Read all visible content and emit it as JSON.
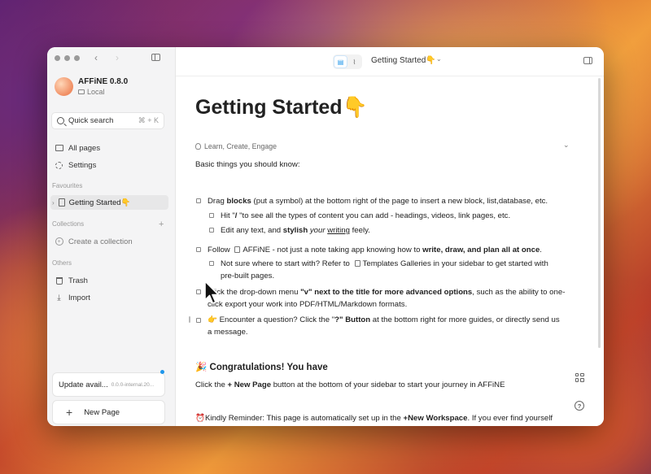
{
  "sidebar": {
    "workspace": {
      "name": "AFFiNE 0.8.0",
      "storage": "Local"
    },
    "quick_search": {
      "label": "Quick search",
      "shortcut": "⌘ + K"
    },
    "nav": [
      {
        "label": "All pages",
        "icon": "folder-icon"
      },
      {
        "label": "Settings",
        "icon": "gear-icon"
      }
    ],
    "favourites_label": "Favourites",
    "favourites": [
      {
        "label": "Getting Started👇"
      }
    ],
    "collections_label": "Collections",
    "create_collection": "Create a collection",
    "others_label": "Others",
    "others": [
      {
        "label": "Trash",
        "icon": "trash-icon"
      },
      {
        "label": "Import",
        "icon": "import-icon"
      }
    ],
    "update": {
      "title": "Update avail...",
      "version": "0.0.0-internal.20..."
    },
    "new_page": "New Page"
  },
  "header": {
    "page_title": "Getting Started👇"
  },
  "doc": {
    "title": "Getting Started👇",
    "tags": "Learn, Create, Engage",
    "intro": "Basic things you should know:",
    "items": {
      "drag_pre": "Drag ",
      "drag_bold": "blocks",
      "drag_post": " (put a symbol) at the bottom right of the page to insert a new block, list,database, etc.",
      "hit_pre": "Hit \"",
      "hit_bold": "/",
      "hit_post": " \"to see all the types of content you can add - headings, videos, link pages, etc.",
      "edit_pre": "Edit any text, and ",
      "edit_bold": "stylish",
      "edit_italic": "your",
      "edit_underline": "writing",
      "edit_post": " feely.",
      "follow_pre": "Follow ",
      "follow_mid": "AFFiNE - not just a note taking app knowing how to ",
      "follow_bold": "write, draw, and plan all at once",
      "follow_post": ".",
      "notsure_pre": "Not sure where to start with? Refer to ",
      "notsure_link": "Templates Galleries",
      "notsure_post1": "   in your sidebar to get started with",
      "notsure_post2": "pre-built pages.",
      "dropdown_pre": "Click the drop-down menu ",
      "dropdown_bold": "\"v\" next to the title for more advanced options",
      "dropdown_post1": ", such as the ability to one-",
      "dropdown_post2": "click export your work into PDF/HTML/Markdown formats.",
      "question_pre": "👉 Encounter a question?  Click the \"",
      "question_bold": "?\" Button",
      "question_post1": " at the bottom right for more guides, or directly send us",
      "question_post2": "a message."
    },
    "congrats_heading": "🎉 Congratulations! You have",
    "congrats_pre": "Click the ",
    "congrats_bold": "+ New Page",
    "congrats_post": " button at the bottom of your sidebar to start your journey in AFFiNE",
    "reminder_pre": "⏰Kindly Reminder: This page is automatically set up in the ",
    "reminder_bold": "+New Workspace",
    "reminder_post": ". If you ever find yourself"
  }
}
